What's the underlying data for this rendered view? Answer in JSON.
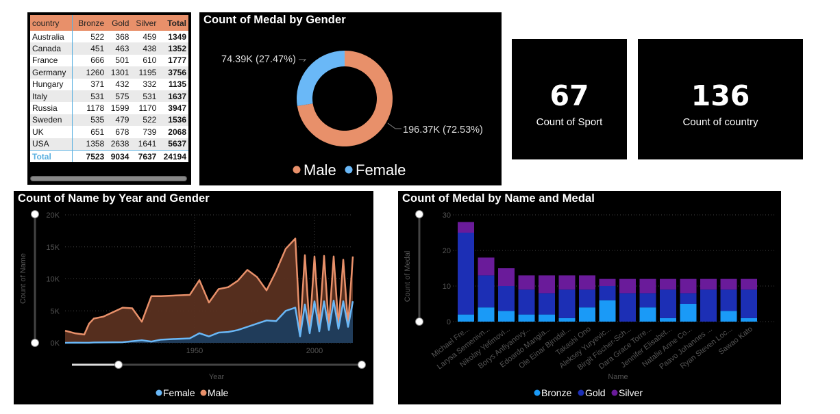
{
  "medal_table": {
    "columns": [
      "country",
      "Bronze",
      "Gold",
      "Silver",
      "Total"
    ],
    "rows": [
      {
        "country": "Australia",
        "bronze": "522",
        "gold": "368",
        "silver": "459",
        "total": "1349"
      },
      {
        "country": "Canada",
        "bronze": "451",
        "gold": "463",
        "silver": "438",
        "total": "1352"
      },
      {
        "country": "France",
        "bronze": "666",
        "gold": "501",
        "silver": "610",
        "total": "1777"
      },
      {
        "country": "Germany",
        "bronze": "1260",
        "gold": "1301",
        "silver": "1195",
        "total": "3756"
      },
      {
        "country": "Hungary",
        "bronze": "371",
        "gold": "432",
        "silver": "332",
        "total": "1135"
      },
      {
        "country": "Italy",
        "bronze": "531",
        "gold": "575",
        "silver": "531",
        "total": "1637"
      },
      {
        "country": "Russia",
        "bronze": "1178",
        "gold": "1599",
        "silver": "1170",
        "total": "3947"
      },
      {
        "country": "Sweden",
        "bronze": "535",
        "gold": "479",
        "silver": "522",
        "total": "1536"
      },
      {
        "country": "UK",
        "bronze": "651",
        "gold": "678",
        "silver": "739",
        "total": "2068"
      },
      {
        "country": "USA",
        "bronze": "1358",
        "gold": "2638",
        "silver": "1641",
        "total": "5637"
      }
    ],
    "total_row": {
      "country": "Total",
      "bronze": "7523",
      "gold": "9034",
      "silver": "7637",
      "total": "24194"
    }
  },
  "cards": {
    "sport": {
      "value": "67",
      "label": "Count of Sport"
    },
    "country": {
      "value": "136",
      "label": "Count of country"
    }
  },
  "colors": {
    "male": "#e8906a",
    "female": "#6ab8f7",
    "bronze": "#1a9af7",
    "gold": "#1c2fb5",
    "silver": "#6a1b9a",
    "grid": "#444444",
    "axis_text": "#555555"
  },
  "icons": [
    "scroll-handle-icon"
  ],
  "chart_data": [
    {
      "type": "pie",
      "title": "Count of Medal by Gender",
      "donut": true,
      "labels": [
        "Male",
        "Female"
      ],
      "values": [
        196370,
        74390
      ],
      "data_labels": [
        "196.37K (72.53%)",
        "74.39K (27.47%)"
      ],
      "legend": "bottom-center"
    },
    {
      "type": "area",
      "title": "Count of Name by Year and Gender",
      "xlabel": "Year",
      "ylabel": "Count of Name",
      "xlim": [
        1896,
        2016
      ],
      "ylim": [
        0,
        20000
      ],
      "xticks": [
        "1950",
        "2000"
      ],
      "yticks": [
        "0K",
        "5K",
        "10K",
        "15K",
        "20K"
      ],
      "legend": "bottom-center",
      "x": [
        1896,
        1900,
        1904,
        1906,
        1908,
        1912,
        1920,
        1924,
        1928,
        1932,
        1936,
        1948,
        1952,
        1956,
        1960,
        1964,
        1968,
        1972,
        1976,
        1980,
        1984,
        1988,
        1992,
        1994,
        1996,
        1998,
        2000,
        2002,
        2004,
        2006,
        2008,
        2010,
        2012,
        2014,
        2016
      ],
      "series": [
        {
          "name": "Female",
          "values": [
            0,
            30,
            10,
            10,
            50,
            70,
            100,
            250,
            400,
            200,
            500,
            700,
            1500,
            1000,
            1600,
            1700,
            2000,
            2500,
            3000,
            3500,
            3400,
            5000,
            5500,
            1000,
            6000,
            1500,
            6500,
            1800,
            6500,
            2000,
            6600,
            2200,
            6500,
            2500,
            6500
          ]
        },
        {
          "name": "Male",
          "values": [
            1900,
            1500,
            1300,
            3000,
            3800,
            4100,
            5500,
            5400,
            3300,
            7300,
            7300,
            7500,
            9800,
            6300,
            8400,
            8700,
            9700,
            11400,
            10300,
            8200,
            11200,
            14700,
            16300,
            1800,
            13700,
            2100,
            13500,
            2400,
            13600,
            2500,
            13500,
            2600,
            13000,
            2800,
            13500
          ]
        }
      ]
    },
    {
      "type": "bar",
      "stacked": true,
      "title": "Count of Medal by Name and Medal",
      "xlabel": "Name",
      "ylabel": "Count of Medal",
      "ylim": [
        0,
        30
      ],
      "yticks": [
        "0",
        "10",
        "20",
        "30"
      ],
      "legend": "bottom-center",
      "categories": [
        "Michael Fre...",
        "Larysa Semenivn...",
        "Nikolay Yefimovi...",
        "Borys Anfiyanovy...",
        "Edoardo Mangia...",
        "Ole Einar Bjrndal...",
        "Takashi Ono",
        "Aleksey Yuryevic...",
        "Birgit Fischer-Sch...",
        "Dara Grace Torre...",
        "Jennifer Elisabet...",
        "Natalie Anne Co...",
        "Paavo Johannes ...",
        "Ryan Steven Loc...",
        "Sawao Kato"
      ],
      "series": [
        {
          "name": "Bronze",
          "values": [
            2,
            4,
            3,
            2,
            2,
            1,
            4,
            6,
            0,
            4,
            1,
            5,
            0,
            3,
            1
          ]
        },
        {
          "name": "Gold",
          "values": [
            23,
            9,
            7,
            7,
            6,
            8,
            5,
            4,
            8,
            4,
            8,
            3,
            9,
            6,
            8
          ]
        },
        {
          "name": "Silver",
          "values": [
            3,
            5,
            5,
            4,
            5,
            4,
            4,
            2,
            4,
            4,
            3,
            4,
            3,
            3,
            3
          ]
        }
      ]
    }
  ]
}
